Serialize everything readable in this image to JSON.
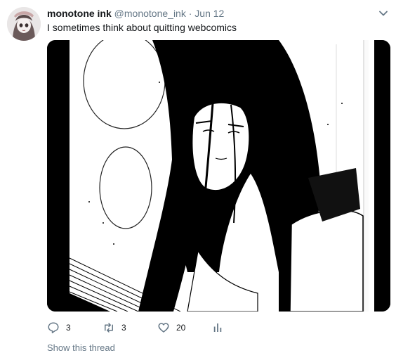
{
  "tweet": {
    "display_name": "monotone ink",
    "handle": "@monotone_ink",
    "separator": "·",
    "date": "Jun 12",
    "text": "I sometimes think about quitting webcomics",
    "avatar_icon": "avatar-illustration",
    "menu_icon": "chevron-down-icon",
    "media_description": "black and white ink illustration"
  },
  "actions": {
    "reply_count": "3",
    "retweet_count": "3",
    "like_count": "20",
    "analytics_icon": "bar-chart-icon"
  },
  "thread": {
    "show_thread_label": "Show this thread"
  },
  "colors": {
    "secondary_text": "#657786",
    "primary_text": "#14171a",
    "background": "#ffffff"
  }
}
